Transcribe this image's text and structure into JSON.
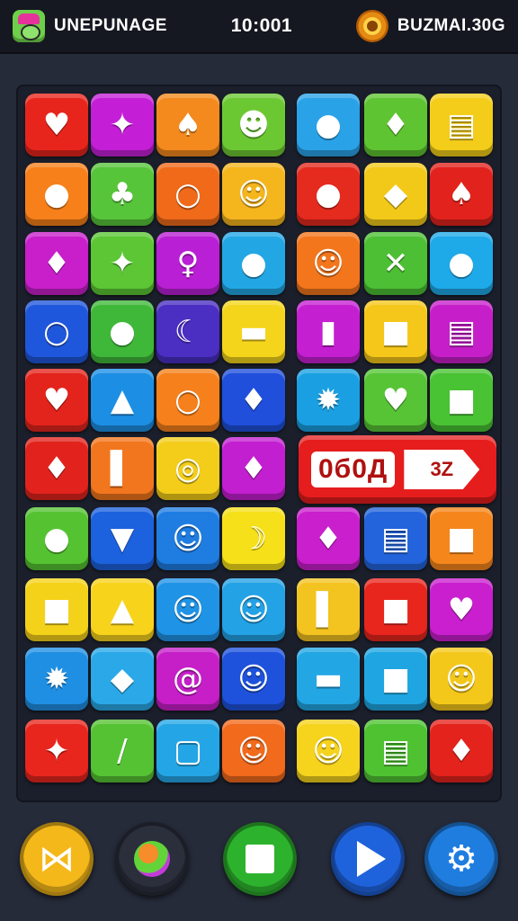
{
  "header": {
    "title": "UNEPUNAGE",
    "timer": "10:001",
    "coins": "BUZMAI.30G",
    "avatar_icon": "monster-avatar-icon",
    "coin_icon": "gold-coin-icon"
  },
  "board": {
    "rows": [
      [
        {
          "name": "heart-icon",
          "glyph": "♥",
          "color": "#e8251c"
        },
        {
          "name": "winged-creature-icon",
          "glyph": "✦",
          "color": "#c41fd6"
        },
        {
          "name": "sack-icon",
          "glyph": "♠",
          "color": "#f48a1d"
        },
        {
          "name": "slime-face-icon",
          "glyph": "☻",
          "color": "#6cc832"
        },
        {
          "name": "lollipop-icon",
          "glyph": "●",
          "color": "#2aa2e8"
        },
        {
          "name": "location-pin-icon",
          "glyph": "♦",
          "color": "#5fc431"
        },
        {
          "name": "cake-icon",
          "glyph": "▤",
          "color": "#f3cd1a"
        }
      ],
      [
        {
          "name": "cookie-icon",
          "glyph": "●",
          "color": "#f7801a"
        },
        {
          "name": "potato-icon",
          "glyph": "♣",
          "color": "#57c53a"
        },
        {
          "name": "orange-icon",
          "glyph": "○",
          "color": "#f06a1a"
        },
        {
          "name": "ghost-icon",
          "glyph": "☺",
          "color": "#f5b51c"
        },
        {
          "name": "apple-icon",
          "glyph": "●",
          "color": "#e52a1e"
        },
        {
          "name": "badge-icon",
          "glyph": "◆",
          "color": "#f2c919"
        },
        {
          "name": "leaf-icon",
          "glyph": "♠",
          "color": "#e2231d"
        }
      ],
      [
        {
          "name": "fish-icon",
          "glyph": "♦",
          "color": "#c81fcb"
        },
        {
          "name": "sparkle-icon",
          "glyph": "✦",
          "color": "#5cc635"
        },
        {
          "name": "mirror-icon",
          "glyph": "♀",
          "color": "#b91fd4"
        },
        {
          "name": "lime-icon",
          "glyph": "●",
          "color": "#22a7e4"
        },
        {
          "name": "mask-face-icon",
          "glyph": "☺",
          "color": "#f3761c"
        },
        {
          "name": "ribbon-icon",
          "glyph": "✕",
          "color": "#4cbf34"
        },
        {
          "name": "lollipop-icon",
          "glyph": "●",
          "color": "#1ea9e8"
        }
      ],
      [
        {
          "name": "ring-icon",
          "glyph": "○",
          "color": "#1f57dc"
        },
        {
          "name": "bug-icon",
          "glyph": "●",
          "color": "#3fb83a"
        },
        {
          "name": "moon-icon",
          "glyph": "☾",
          "color": "#4a2fc2"
        },
        {
          "name": "roll-icon",
          "glyph": "▬",
          "color": "#f4d51b"
        },
        {
          "name": "battery-icon",
          "glyph": "▮",
          "color": "#c51fd2"
        },
        {
          "name": "ticket-icon",
          "glyph": "■",
          "color": "#f5c71a"
        },
        {
          "name": "shop-icon",
          "glyph": "▤",
          "color": "#c61fc9"
        }
      ],
      [
        {
          "name": "heart-icon",
          "glyph": "♥",
          "color": "#e3241c"
        },
        {
          "name": "cheese-icon",
          "glyph": "▲",
          "color": "#1c8fe4"
        },
        {
          "name": "orange-icon",
          "glyph": "○",
          "color": "#f5801c"
        },
        {
          "name": "pepper-icon",
          "glyph": "♦",
          "color": "#1f4fdb"
        },
        {
          "name": "sun-gear-icon",
          "glyph": "✹",
          "color": "#1aa0e2"
        },
        {
          "name": "radish-icon",
          "glyph": "♥",
          "color": "#56c435"
        },
        {
          "name": "robot-box-icon",
          "glyph": "■",
          "color": "#49c233"
        }
      ],
      [
        {
          "name": "fish-icon",
          "glyph": "♦",
          "color": "#e2231d"
        },
        {
          "name": "flag-icon",
          "glyph": "▌",
          "color": "#f2761d"
        },
        {
          "name": "spiral-icon",
          "glyph": "◎",
          "color": "#f3cd1a"
        },
        {
          "name": "fire-dash-icon",
          "glyph": "♦",
          "color": "#c21fd0"
        }
      ],
      [
        {
          "name": "speech-bubble-icon",
          "glyph": "●",
          "color": "#55c232"
        },
        {
          "name": "ice-cream-icon",
          "glyph": "▼",
          "color": "#1c61de"
        },
        {
          "name": "bottle-face-icon",
          "glyph": "☺",
          "color": "#1f7de2"
        },
        {
          "name": "banana-icon",
          "glyph": "☽",
          "color": "#f5e01a"
        },
        {
          "name": "drop-icon",
          "glyph": "♦",
          "color": "#c91fcc"
        },
        {
          "name": "book-icon",
          "glyph": "▤",
          "color": "#2364dc"
        },
        {
          "name": "box-icon",
          "glyph": "■",
          "color": "#f5861c"
        }
      ],
      [
        {
          "name": "square-icon",
          "glyph": "■",
          "color": "#f5d21a"
        },
        {
          "name": "hand-icon",
          "glyph": "▲",
          "color": "#f7d31c"
        },
        {
          "name": "ghost-face-icon",
          "glyph": "☺",
          "color": "#1f93e6"
        },
        {
          "name": "lion-icon",
          "glyph": "☺",
          "color": "#23a2e5"
        },
        {
          "name": "green-card-icon",
          "glyph": "▌",
          "color": "#f3c320"
        },
        {
          "name": "cube-icon",
          "glyph": "■",
          "color": "#e8261e"
        },
        {
          "name": "heart-icon",
          "glyph": "♥",
          "color": "#c91fce"
        }
      ],
      [
        {
          "name": "sun-face-icon",
          "glyph": "✹",
          "color": "#1f8fe3"
        },
        {
          "name": "diamond-face-icon",
          "glyph": "◆",
          "color": "#2aa8e8"
        },
        {
          "name": "swirl-icon",
          "glyph": "@",
          "color": "#c61fc8"
        },
        {
          "name": "happy-face-icon",
          "glyph": "☺",
          "color": "#1e52dc"
        },
        {
          "name": "paint-roller-icon",
          "glyph": "▬",
          "color": "#22a7e4"
        },
        {
          "name": "frame-icon",
          "glyph": "■",
          "color": "#1fa6e2"
        },
        {
          "name": "giraffe-icon",
          "glyph": "☺",
          "color": "#f4c81a"
        }
      ],
      [
        {
          "name": "star-icon",
          "glyph": "✦",
          "color": "#e8261e"
        },
        {
          "name": "wand-icon",
          "glyph": "/",
          "color": "#55c233"
        },
        {
          "name": "tablet-icon",
          "glyph": "▢",
          "color": "#24a6e6"
        },
        {
          "name": "flower-face-icon",
          "glyph": "☺",
          "color": "#f26a1c"
        },
        {
          "name": "cat-face-icon",
          "glyph": "☺",
          "color": "#f6d31c"
        },
        {
          "name": "chart-card-icon",
          "glyph": "▤",
          "color": "#4fc232"
        },
        {
          "name": "carrot-icon",
          "glyph": "♦",
          "color": "#e4231d"
        }
      ]
    ]
  },
  "banner": {
    "text": "0б0Д",
    "tag": "3Z",
    "color": "#e51d1d"
  },
  "controls": [
    {
      "name": "skip-icon",
      "glyph": "⋈",
      "color": "#f5b81a"
    },
    {
      "name": "monster-power-icon",
      "glyph": "●",
      "color": "#2b2f3c"
    },
    {
      "name": "stop-icon",
      "glyph": "",
      "color": "#2db22d"
    },
    {
      "name": "play-icon",
      "glyph": "",
      "color": "#1f63dc"
    },
    {
      "name": "gear-icon",
      "glyph": "⚙",
      "color": "#1f7ddf"
    }
  ]
}
